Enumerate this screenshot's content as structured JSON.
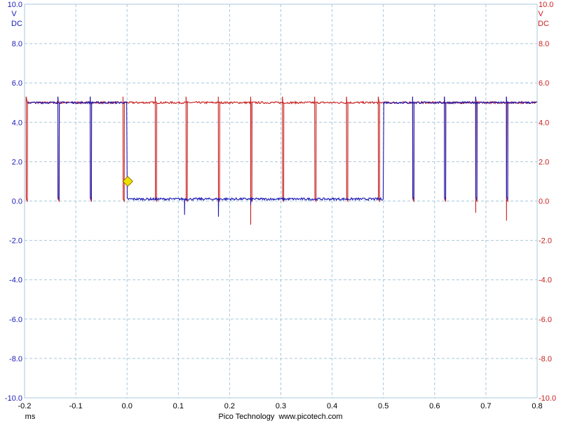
{
  "chart_data": {
    "type": "line",
    "x_unit": "ms",
    "xlim": [
      -0.2,
      0.8
    ],
    "x_ticks": [
      "-0.2",
      "-0.1",
      "0.0",
      "0.1",
      "0.2",
      "0.3",
      "0.4",
      "0.5",
      "0.6",
      "0.7",
      "0.8"
    ],
    "ylim": [
      -10.0,
      10.0
    ],
    "y_ticks": [
      "10.0",
      "8.0",
      "6.0",
      "4.0",
      "2.0",
      "0.0",
      "-2.0",
      "-4.0",
      "-6.0",
      "-8.0",
      "-10.0"
    ],
    "left_axis": {
      "unit_line1": "V",
      "unit_line2": "DC",
      "color": "#1a1ab4"
    },
    "right_axis": {
      "unit_line1": "V",
      "unit_line2": "DC",
      "color": "#c81e1e"
    },
    "grid": true,
    "grid_color": "#a8c8dc",
    "series": [
      {
        "color": "#1a1ab4",
        "high_level": 5.0,
        "low_level": 0.1,
        "low_interval": [
          0.0,
          0.5
        ],
        "pulse_dips_ms": [
          -0.135,
          -0.072,
          0.557,
          0.619,
          0.68,
          0.74
        ],
        "spikes": [
          {
            "x": 0.112,
            "y": -0.7
          },
          {
            "x": 0.178,
            "y": -0.8
          },
          {
            "x": 0.241,
            "y": -0.2
          }
        ]
      },
      {
        "color": "#c81e1e",
        "high_level": 5.0,
        "low_level": 0.0,
        "pulse_dips_ms": [
          -0.197,
          -0.135,
          -0.072,
          -0.008,
          0.055,
          0.115,
          0.178,
          0.241,
          0.303,
          0.366,
          0.428,
          0.49,
          0.557,
          0.619,
          0.68,
          0.74
        ],
        "spikes": [
          {
            "x": 0.241,
            "y": -1.2
          },
          {
            "x": 0.68,
            "y": -0.6
          },
          {
            "x": 0.74,
            "y": -1.0
          }
        ]
      }
    ],
    "trigger_marker": {
      "x": 0.0,
      "y": 1.0,
      "color": "#f0e000"
    }
  },
  "footer": {
    "x_unit_label": "ms",
    "credit": "Pico Technology  www.picotech.com"
  }
}
